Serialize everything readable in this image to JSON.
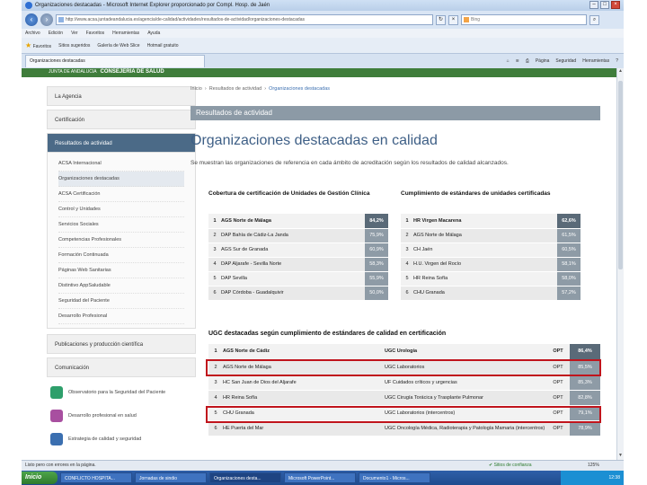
{
  "browser": {
    "window_title": "Organizaciones destacadas - Microsoft Internet Explorer proporcionado por Compl. Hosp. de Jaén",
    "url": "http://www.acsa.juntadeandalucia.es/agencia/de-calidad/actividades/resultados-de-actividad/organizaciones-destacadas",
    "search_placeholder": "Bing",
    "menu": [
      "Archivo",
      "Edición",
      "Ver",
      "Favoritos",
      "Herramientas",
      "Ayuda"
    ],
    "favorites": [
      "Favoritos",
      "Sitios sugeridos",
      "Galería de Web Slice",
      "Hotmail gratuito"
    ],
    "tab_label": "Organizaciones destacadas",
    "commands": [
      "Página",
      "Seguridad",
      "Herramientas"
    ]
  },
  "site": {
    "org": "JUNTA DE ANDALUCIA",
    "dept": "CONSEJERÍA DE SALUD"
  },
  "sidebar": {
    "sections": [
      "La Agencia",
      "Certificación",
      "Resultados de actividad"
    ],
    "sub_items": [
      "ACSA Internacional",
      "Organizaciones destacadas",
      "ACSA Certificación",
      "Control y Unidades",
      "Servicios Sociales",
      "Competencias Profesionales",
      "Formación Continuada",
      "Páginas Web Sanitarias",
      "Distintivo AppSaludable",
      "Seguridad del Paciente",
      "Desarrollo Profesional"
    ],
    "sections_after": [
      "Publicaciones y producción científica",
      "Comunicación"
    ],
    "promos": [
      "Observatorio para la Seguridad del Paciente",
      "Desarrollo profesional en salud",
      "Estrategia de calidad y seguridad"
    ]
  },
  "main": {
    "breadcrumb": [
      "Inicio",
      "Resultados de actividad",
      "Organizaciones destacadas"
    ],
    "banner": "Resultados de actividad",
    "title": "Organizaciones destacadas en calidad",
    "intro": "Se muestran las organizaciones de referencia en cada ámbito de acreditación según los resultados de calidad alcanzados.",
    "left_table": {
      "title": "Cobertura de certificación de Unidades de Gestión Clínica",
      "rows": [
        {
          "n": "1",
          "name": "AGS Norte de Málaga",
          "value": "84,2%"
        },
        {
          "n": "2",
          "name": "DAP Bahía de Cádiz-La Janda",
          "value": "75,9%"
        },
        {
          "n": "3",
          "name": "AGS Sur de Granada",
          "value": "60,9%"
        },
        {
          "n": "4",
          "name": "DAP Aljarafe - Sevilla Norte",
          "value": "58,3%"
        },
        {
          "n": "5",
          "name": "DAP Sevilla",
          "value": "55,9%"
        },
        {
          "n": "6",
          "name": "DAP Córdoba - Guadalquivir",
          "value": "50,0%"
        }
      ]
    },
    "right_table": {
      "title": "Cumplimiento de estándares de unidades certificadas",
      "rows": [
        {
          "n": "1",
          "name": "HR Virgen Macarena",
          "value": "62,6%"
        },
        {
          "n": "2",
          "name": "AGS Norte de Málaga",
          "value": "61,5%"
        },
        {
          "n": "3",
          "name": "CH Jaén",
          "value": "60,5%"
        },
        {
          "n": "4",
          "name": "H.U. Virgen del Rocío",
          "value": "58,1%"
        },
        {
          "n": "5",
          "name": "HR Reina Sofía",
          "value": "58,0%"
        },
        {
          "n": "6",
          "name": "CHU Granada",
          "value": "57,2%"
        }
      ]
    },
    "ugc": {
      "title": "UGC destacadas según cumplimiento de estándares de calidad en certificación",
      "rows": [
        {
          "n": "1",
          "center": "AGS Norte de Cádiz",
          "unit": "UGC Urología",
          "level": "OPT",
          "value": "86,4%"
        },
        {
          "n": "2",
          "center": "AGS Norte de Málaga",
          "unit": "UGC Laboratorios",
          "level": "OPT",
          "value": "85,5%"
        },
        {
          "n": "3",
          "center": "HC San Juan de Dios del Aljarafe",
          "unit": "UF Cuidados críticos y urgencias",
          "level": "OPT",
          "value": "85,3%"
        },
        {
          "n": "4",
          "center": "HR Reina Sofía",
          "unit": "UGC Cirugía Torácica y Trasplante Pulmonar",
          "level": "OPT",
          "value": "82,8%"
        },
        {
          "n": "5",
          "center": "CHU Granada",
          "unit": "UGC Laboratorios (intercentros)",
          "level": "OPT",
          "value": "79,1%"
        },
        {
          "n": "6",
          "center": "HE Puerta del Mar",
          "unit": "UGC Oncología Médica, Radioterapia y Patología Mamaria (intercentros)",
          "level": "OPT",
          "value": "78,9%"
        }
      ]
    }
  },
  "status": {
    "text": "Listo pero con errores en la página.",
    "zone": "Sitios de confianza",
    "zoom": "125%"
  },
  "taskbar": {
    "start": "Inicio",
    "tasks": [
      "CONFLICTO HOSPITA...",
      "Jornadas de sindio",
      "Organizaciones desta...",
      "Microsoft PowerPoint...",
      "Documento1 - Micros..."
    ],
    "clock": "12:38"
  }
}
